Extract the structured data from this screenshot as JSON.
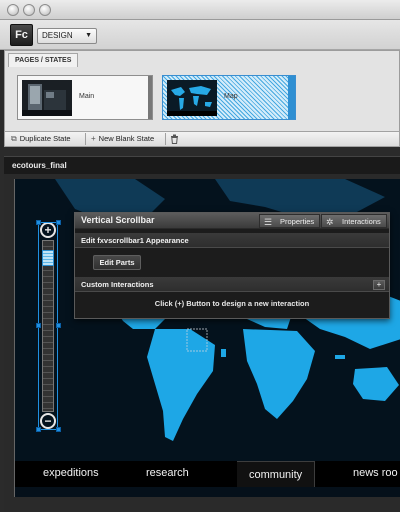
{
  "app": {
    "logo": "Fc",
    "workspace": "DESIGN"
  },
  "pages_panel": {
    "tab_label": "PAGES / STATES",
    "states": [
      {
        "name": "Main",
        "selected": false
      },
      {
        "name": "Map",
        "selected": true
      }
    ],
    "duplicate_label": "Duplicate State",
    "new_blank_label": "New Blank State"
  },
  "document": {
    "title": "ecotours_final"
  },
  "nav": {
    "items": [
      "expeditions",
      "research",
      "community",
      "news roo"
    ],
    "active": "community"
  },
  "popup": {
    "title": "Vertical Scrollbar",
    "properties_tab": "Properties",
    "interactions_tab": "Interactions",
    "appearance_heading": "Edit fxvscrollbar1 Appearance",
    "edit_parts_label": "Edit Parts",
    "custom_interactions_heading": "Custom Interactions",
    "add_label": "+",
    "hint": "Click (+) Button to design a new interaction"
  },
  "colors": {
    "accent": "#1f8fe0",
    "map_land": "#1ea7e6",
    "map_background": "#05101a"
  }
}
